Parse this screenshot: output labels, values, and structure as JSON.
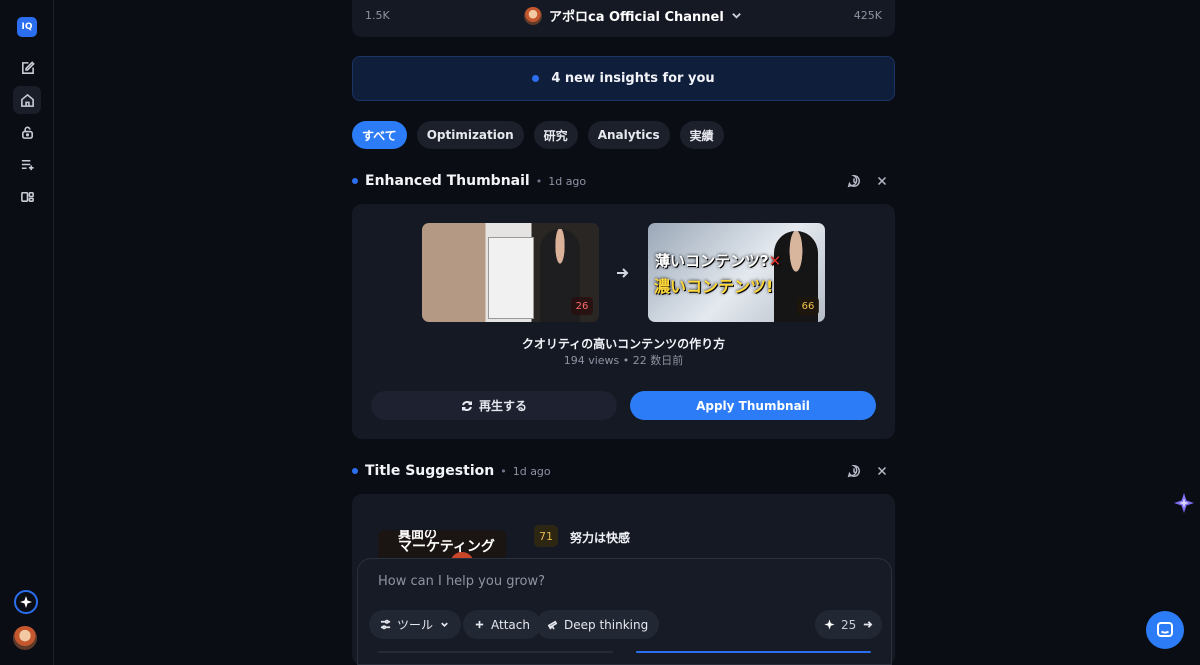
{
  "app": {
    "logo_text": "IQ"
  },
  "rail": {
    "items": [
      {
        "icon": "edit-icon"
      },
      {
        "icon": "home-icon",
        "active": true
      },
      {
        "icon": "lock-icon"
      },
      {
        "icon": "playlist-add-icon"
      },
      {
        "icon": "dashboard-icon"
      }
    ]
  },
  "stats_chart": {
    "min_label": "1.5K",
    "max_label": "425K",
    "channel_name": "アポロca Official Channel"
  },
  "insights_banner": {
    "text": "4 new insights for you"
  },
  "filters": {
    "chips": [
      "すべて",
      "Optimization",
      "研究",
      "Analytics",
      "実績"
    ],
    "active_index": 0
  },
  "thumbnail_insight": {
    "title": "Enhanced Thumbnail",
    "time": "1d ago",
    "old_score": "26",
    "new_score": "66",
    "new_text_line1": "薄いコンテンツ?",
    "new_text_line1_mark": "✕",
    "new_text_line2": "濃いコンテンツ!",
    "video_title": "クオリティの高いコンテンツの作り方",
    "video_meta": "194 views • 22 数日前",
    "regenerate_label": "再生する",
    "apply_label": "Apply Thumbnail"
  },
  "title_insight": {
    "title": "Title Suggestion",
    "time": "1d ago",
    "thumb_line1": "真面の",
    "thumb_line2": "マーケティング",
    "score": "71",
    "suggestion": "努力は快感"
  },
  "composer": {
    "placeholder": "How can I help you grow?",
    "tools_label": "ツール",
    "attach_label": "Attach",
    "deep_label": "Deep thinking",
    "credits": "25"
  },
  "colors": {
    "accent": "#2b7cf6",
    "background": "#0b0d14",
    "card": "#151923"
  }
}
